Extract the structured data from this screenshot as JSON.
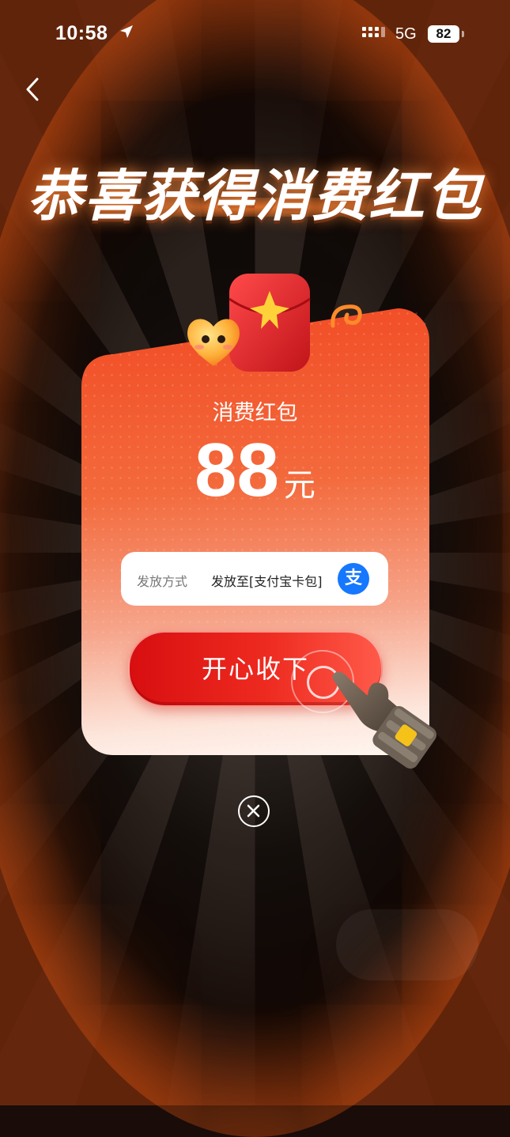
{
  "status_bar": {
    "time": "10:58",
    "network": "5G",
    "battery": "82"
  },
  "title": "恭喜获得消费红包",
  "card": {
    "label": "消费红包",
    "amount": "88",
    "unit": "元",
    "method_label": "发放方式",
    "method_value": "发放至[支付宝卡包]",
    "alipay_glyph": "支",
    "accept_button": "开心收下"
  },
  "colors": {
    "accent": "#f04420",
    "button": "#e41818",
    "alipay": "#1677ff"
  }
}
